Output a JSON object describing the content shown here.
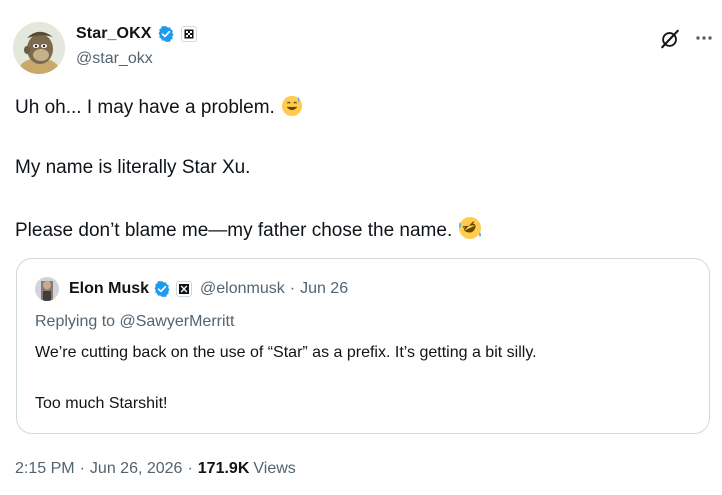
{
  "author": {
    "display_name": "Star_OKX",
    "handle": "@star_okx"
  },
  "tweet": {
    "lines": [
      "Uh oh... I may have a problem.",
      "My name is literally Star Xu.",
      "Please don’t blame me—my father chose the name."
    ]
  },
  "quote": {
    "display_name": "Elon Musk",
    "handle": "@elonmusk",
    "separator": "·",
    "date": "Jun 26",
    "replying_to": "Replying to @SawyerMerritt",
    "lines": [
      "We’re cutting back on the use of “Star” as a prefix. It’s getting a bit silly.",
      "Too much Starshit!"
    ]
  },
  "meta": {
    "time": "2:15 PM",
    "separator": "·",
    "date": "Jun 26, 2026",
    "views_count": "171.9K",
    "views_label": "Views"
  },
  "icons": {
    "verified": "verified-badge-icon",
    "grok": "grok-icon",
    "more": "more-icon",
    "emoji_sweat": "grinning-sweat-emoji",
    "emoji_rofl": "rolling-laughing-emoji"
  },
  "colors": {
    "verified_blue": "#1d9bf0",
    "secondary_text": "#536471",
    "primary_text": "#0f1419",
    "border": "#cfd9de"
  }
}
